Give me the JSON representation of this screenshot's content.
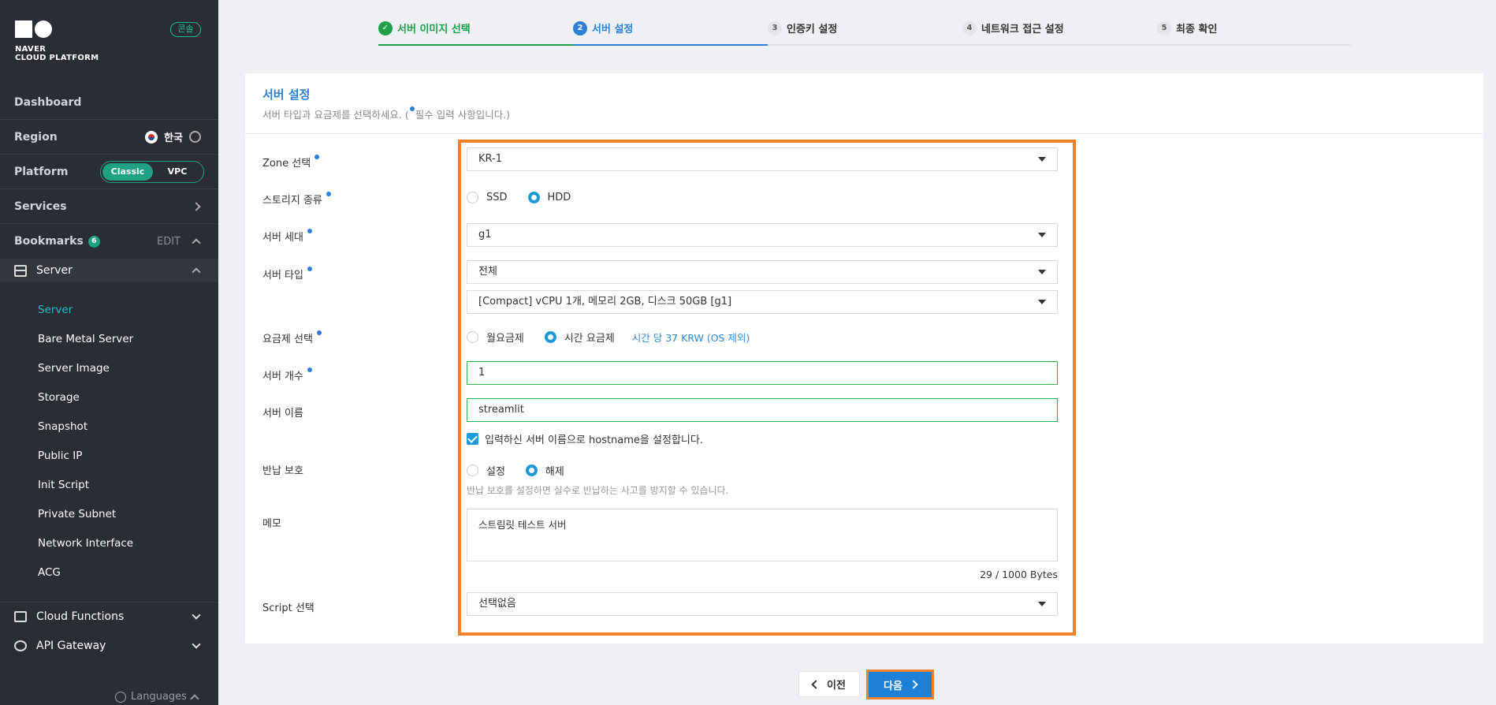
{
  "sidebar": {
    "logo_line1": "NAVER",
    "logo_line2": "CLOUD PLATFORM",
    "console_badge": "콘솔",
    "dashboard": "Dashboard",
    "region_label": "Region",
    "region_value": "한국",
    "platform_label": "Platform",
    "platform_classic": "Classic",
    "platform_vpc": "VPC",
    "services": "Services",
    "bookmarks": "Bookmarks",
    "bookmarks_count": "6",
    "bookmarks_edit": "EDIT",
    "server_section": "Server",
    "submenu": [
      "Server",
      "Bare Metal Server",
      "Server Image",
      "Storage",
      "Snapshot",
      "Public IP",
      "Init Script",
      "Private Subnet",
      "Network Interface",
      "ACG"
    ],
    "cloud_functions": "Cloud Functions",
    "api_gateway": "API Gateway",
    "languages": "Languages"
  },
  "steps": [
    {
      "num": "1",
      "label": "서버 이미지 선택",
      "state": "done"
    },
    {
      "num": "2",
      "label": "서버 설정",
      "state": "active"
    },
    {
      "num": "3",
      "label": "인증키 설정",
      "state": "todo"
    },
    {
      "num": "4",
      "label": "네트워크 접근 설정",
      "state": "todo"
    },
    {
      "num": "5",
      "label": "최종 확인",
      "state": "todo"
    }
  ],
  "card": {
    "title": "서버 설정",
    "subtitle_pre": "서버 타입과 요금제를 선택하세요. (",
    "subtitle_post": "필수 입력 사항입니다.)"
  },
  "form": {
    "zone_label": "Zone 선택",
    "zone_value": "KR-1",
    "storage_label": "스토리지 종류",
    "storage_ssd": "SSD",
    "storage_hdd": "HDD",
    "generation_label": "서버 세대",
    "generation_value": "g1",
    "type_label": "서버 타입",
    "type_value": "전체",
    "spec_value": "[Compact] vCPU 1개, 메모리 2GB, 디스크 50GB [g1]",
    "pricing_label": "요금제 선택",
    "pricing_monthly": "월요금제",
    "pricing_hourly": "시간 요금제",
    "pricing_note": "시간 당 37 KRW (OS 제외)",
    "count_label": "서버 개수",
    "count_value": "1",
    "name_label": "서버 이름",
    "name_value": "streamlit",
    "hostname_check": "입력하신 서버 이름으로 hostname을 설정합니다.",
    "protect_label": "반납 보호",
    "protect_on": "설정",
    "protect_off": "해제",
    "protect_hint": "반납 보호를 설정하면 실수로 반납하는 사고를 방지할 수 있습니다.",
    "memo_label": "메모",
    "memo_value": "스트림릿 테스트 서버",
    "memo_counter": "29 / 1000 Bytes",
    "script_label": "Script 선택",
    "script_value": "선택없음"
  },
  "buttons": {
    "prev": "이전",
    "next": "다음"
  },
  "colors": {
    "accent_blue": "#2b7fd6",
    "done_green": "#1fa14a",
    "highlight_orange": "#f0822a",
    "sidebar_bg": "#2a2d34"
  }
}
